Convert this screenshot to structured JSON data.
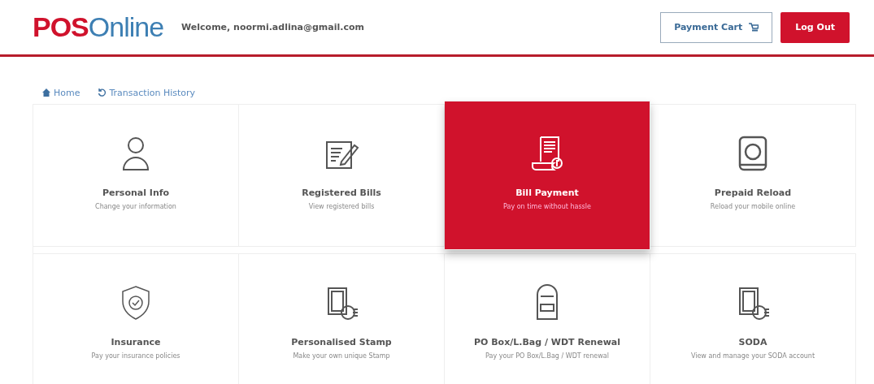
{
  "header": {
    "logo": {
      "brand": "POS",
      "suffix": "Online"
    },
    "welcome": "Welcome, noormi.adlina@gmail.com",
    "buttons": {
      "cart": "Payment Cart",
      "logout": "Log Out"
    }
  },
  "breadcrumbs": [
    {
      "label": "Home",
      "kind": "home"
    },
    {
      "label": "Transaction History",
      "kind": "history"
    }
  ],
  "services": [
    {
      "title": "Personal Info",
      "subtitle": "Change your information",
      "kind": "person",
      "selected": false
    },
    {
      "title": "Registered Bills",
      "subtitle": "View registered bills",
      "kind": "edit",
      "selected": false
    },
    {
      "title": "Bill Payment",
      "subtitle": "Pay on time without hassle",
      "kind": "receipt",
      "selected": true
    },
    {
      "title": "Prepaid Reload",
      "subtitle": "Reload your mobile online",
      "kind": "phone",
      "selected": false
    },
    {
      "title": "Insurance",
      "subtitle": "Pay your insurance policies",
      "kind": "shield",
      "selected": false
    },
    {
      "title": "Personalised Stamp",
      "subtitle": "Make your own unique Stamp",
      "kind": "stamp",
      "selected": false
    },
    {
      "title": "PO Box/L.Bag / WDT Renewal",
      "subtitle": "Pay your PO Box/L.Bag / WDT renewal",
      "kind": "mailbox",
      "selected": false
    },
    {
      "title": "SODA",
      "subtitle": "View and manage your SODA account",
      "kind": "stamp",
      "selected": false
    }
  ]
}
